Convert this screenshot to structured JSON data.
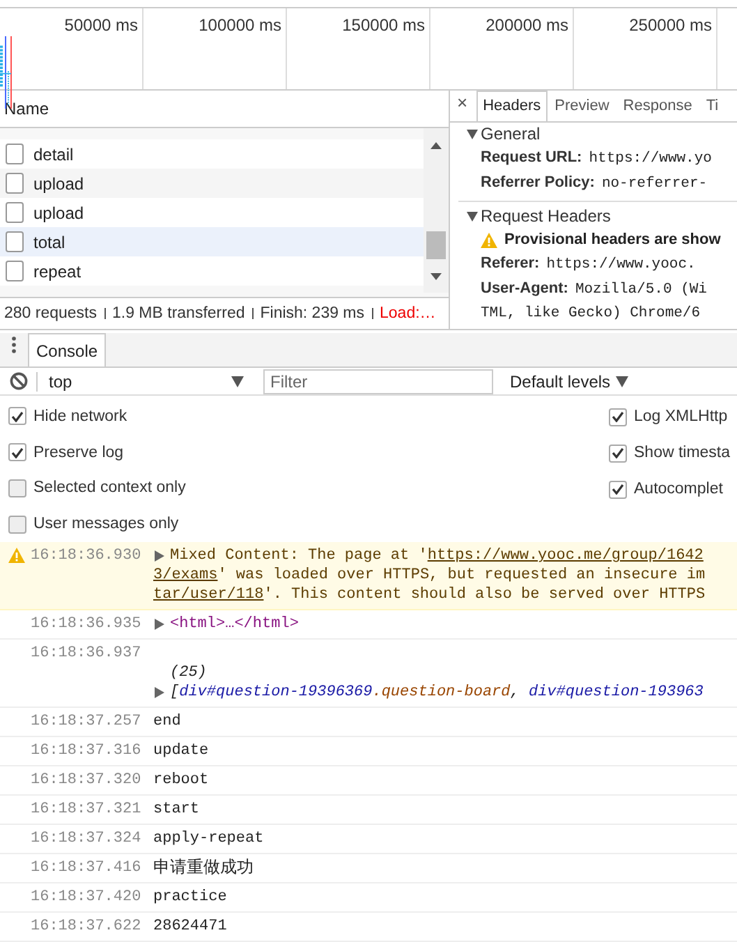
{
  "timeline": {
    "ticks": [
      "50000 ms",
      "100000 ms",
      "150000 ms",
      "200000 ms",
      "250000 ms"
    ]
  },
  "network": {
    "column": "Name",
    "rows": [
      {
        "name": "detail",
        "selected": false
      },
      {
        "name": "upload",
        "selected": false
      },
      {
        "name": "upload",
        "selected": false
      },
      {
        "name": "total",
        "selected": true
      },
      {
        "name": "repeat",
        "selected": false
      }
    ],
    "status": [
      "280 requests",
      "1.9 MB transferred",
      "Finish: 239 ms",
      "Load:…"
    ]
  },
  "details": {
    "close": "×",
    "tabs": [
      {
        "label": "Headers",
        "selected": true
      },
      {
        "label": "Preview",
        "selected": false
      },
      {
        "label": "Response",
        "selected": false
      },
      {
        "label": "Ti",
        "selected": false
      }
    ],
    "sections": [
      {
        "title": "General",
        "expanded": true,
        "fields": [
          {
            "key": "Request URL:",
            "values": [
              "https://www.yo"
            ]
          },
          {
            "key": "Referrer Policy:",
            "values": [
              "no-referrer-"
            ]
          }
        ]
      },
      {
        "title": "Request Headers",
        "expanded": true,
        "warning": "Provisional headers are show",
        "fields": [
          {
            "key": "Referer:",
            "values": [
              "https://www.yooc."
            ]
          },
          {
            "key": "User-Agent:",
            "values": [
              "Mozilla/5.0 (Wi",
              "TML, like Gecko) Chrome/6"
            ]
          }
        ]
      }
    ]
  },
  "drawer": {
    "tabs": [
      {
        "label": "Console",
        "selected": true
      }
    ]
  },
  "toolbar": {
    "context": "top",
    "filter_placeholder": "Filter",
    "levels": "Default levels"
  },
  "settings": {
    "left": [
      {
        "label": "Hide network",
        "checked": true
      },
      {
        "label": "Preserve log",
        "checked": true
      },
      {
        "label": "Selected context only",
        "checked": false
      },
      {
        "label": "User messages only",
        "checked": false
      }
    ],
    "right": [
      {
        "label": "Log XMLHttp",
        "checked": true
      },
      {
        "label": "Show timesta",
        "checked": true
      },
      {
        "label": "Autocomplet",
        "checked": true
      }
    ]
  },
  "messages": [
    {
      "kind": "warning",
      "time": "16:18:36.930",
      "lines": [
        [
          {
            "kind": "text",
            "text": "Mixed Content: The page at '"
          },
          {
            "kind": "link",
            "text": "https://www.yooc.me/group/1642"
          }
        ],
        [
          {
            "kind": "link",
            "text": "3/exams"
          },
          {
            "kind": "text",
            "text": "' was loaded over HTTPS, but requested an insecure im"
          }
        ],
        [
          {
            "kind": "link",
            "text": "tar/user/118"
          },
          {
            "kind": "text",
            "text": "'. This content should also be served over HTTPS"
          }
        ]
      ]
    },
    {
      "kind": "element",
      "time": "16:18:36.935",
      "text": "<html>…</html>"
    },
    {
      "kind": "array",
      "time": "16:18:36.937",
      "count": "(25)",
      "parts": [
        {
          "kind": "punct",
          "text": "["
        },
        {
          "kind": "tag",
          "text": "div#question-19396369"
        },
        {
          "kind": "class",
          "text": ".question-board"
        },
        {
          "kind": "punct",
          "text": ", "
        },
        {
          "kind": "tag",
          "text": "div#question-193963"
        }
      ]
    },
    {
      "kind": "log",
      "time": "16:18:37.257",
      "text": "end"
    },
    {
      "kind": "log",
      "time": "16:18:37.316",
      "text": "update"
    },
    {
      "kind": "log",
      "time": "16:18:37.320",
      "text": "reboot"
    },
    {
      "kind": "log",
      "time": "16:18:37.321",
      "text": "start"
    },
    {
      "kind": "log",
      "time": "16:18:37.324",
      "text": "apply-repeat"
    },
    {
      "kind": "log",
      "time": "16:18:37.416",
      "text": "申请重做成功"
    },
    {
      "kind": "log",
      "time": "16:18:37.420",
      "text": "practice"
    },
    {
      "kind": "log",
      "time": "16:18:37.622",
      "text": "28624471"
    }
  ]
}
